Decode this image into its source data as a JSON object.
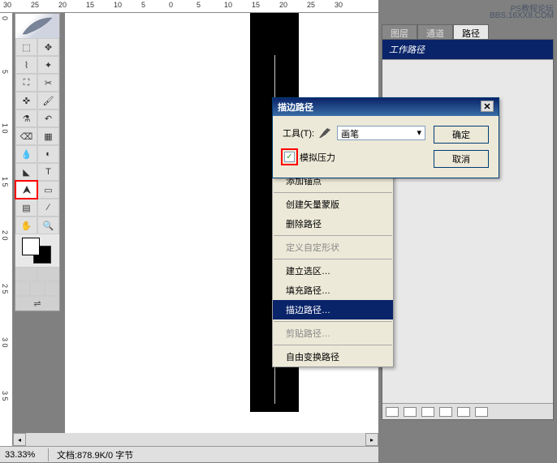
{
  "watermark": {
    "line1": "PS教程论坛",
    "line2": "BBS.16XX8.COM"
  },
  "ruler": {
    "marks": [
      "30",
      "25",
      "20",
      "15",
      "10",
      "5",
      "0",
      "5",
      "10",
      "15",
      "20",
      "25",
      "30"
    ]
  },
  "ruler_v": {
    "marks": [
      "0",
      "5",
      "1 0",
      "1 5",
      "2 0",
      "2 5",
      "3 0",
      "3 5"
    ]
  },
  "tabs": {
    "layers": "图层",
    "channels": "通道",
    "paths": "路径"
  },
  "paths_panel": {
    "work_path": "工作路径"
  },
  "dialog": {
    "title": "描边路径",
    "tool_label": "工具(T):",
    "tool_value": "画笔",
    "simulate_pressure": "模拟压力",
    "ok": "确定",
    "cancel": "取消"
  },
  "context_menu": {
    "add_anchor": "添加锚点",
    "create_vector_mask": "创建矢量蒙版",
    "delete_path": "删除路径",
    "define_custom_shape": "定义自定形状",
    "make_selection": "建立选区…",
    "fill_path": "填充路径…",
    "stroke_path": "描边路径…",
    "clip_path": "剪贴路径…",
    "free_transform_path": "自由变换路径"
  },
  "status": {
    "zoom": "33.33%",
    "doc": "文档:878.9K/0 字节"
  },
  "tools": {
    "names": [
      "marquee",
      "move",
      "lasso",
      "wand",
      "crop",
      "slice",
      "healing",
      "brush",
      "stamp",
      "history",
      "eraser",
      "gradient",
      "blur",
      "dodge",
      "path-select",
      "type",
      "pen",
      "shape",
      "notes",
      "eyedropper",
      "hand",
      "zoom"
    ]
  }
}
